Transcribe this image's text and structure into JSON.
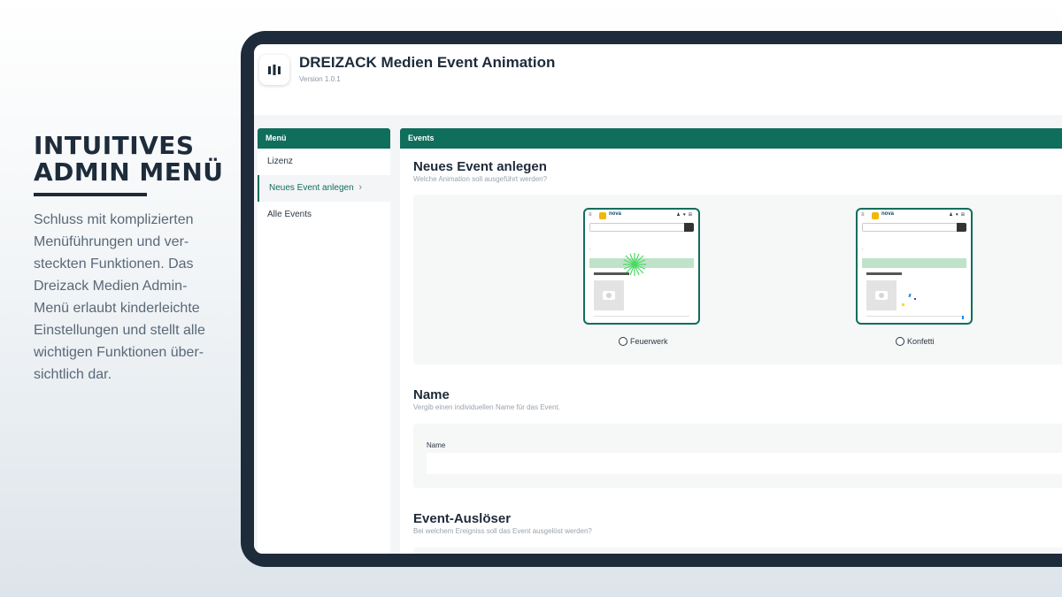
{
  "promo": {
    "title_line1": "INTUITIVES",
    "title_line2": "ADMIN MENÜ",
    "text_lines": [
      "Schluss mit komplizierten",
      "Menüführungen und ver-",
      "steckten Funktionen. Das",
      "Dreizack Medien Admin-",
      "Menü erlaubt kinderleichte",
      "Einstellungen und stellt alle",
      "wichtigen Funktionen über-",
      "sichtlich dar."
    ]
  },
  "app": {
    "title": "DREIZACK Medien Event Animation",
    "version": "Version 1.0.1"
  },
  "sidebar": {
    "header": "Menü",
    "items": [
      {
        "label": "Lizenz"
      },
      {
        "label": "Neues Event anlegen"
      },
      {
        "label": "Alle Events"
      }
    ]
  },
  "main": {
    "header": "Events",
    "new_event": {
      "title": "Neues Event anlegen",
      "subtitle": "Welche Animation soll ausgeführt werden?"
    },
    "animations": [
      {
        "label": "Feuerwerk",
        "brand": "nova"
      },
      {
        "label": "Konfetti",
        "brand": "nova"
      }
    ],
    "name_section": {
      "title": "Name",
      "subtitle": "Vergib einen individuellen Name für das Event.",
      "field_label": "Name",
      "field_value": ""
    },
    "trigger_section": {
      "title": "Event-Auslöser",
      "subtitle": "Bei welchem Ereigniss soll das Event ausgelöst werden?"
    }
  },
  "colors": {
    "accent": "#0f6e5c",
    "frame": "#1d2b3a",
    "brand_yellow": "#f2b700"
  }
}
